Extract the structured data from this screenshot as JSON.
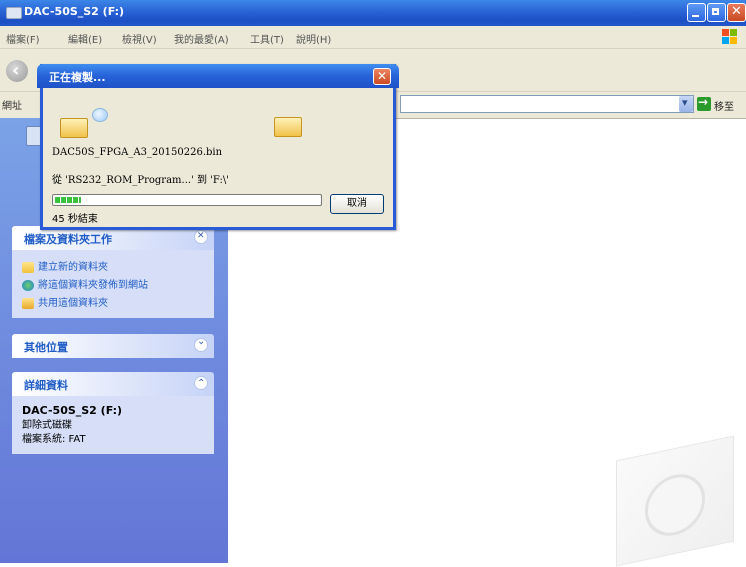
{
  "window": {
    "title": "DAC-50S_S2 (F:)",
    "menu": [
      "檔案(F)",
      "編輯(E)",
      "檢視(V)",
      "我的最愛(A)",
      "工具(T)",
      "說明(H)"
    ],
    "address_label": "網址",
    "go_label": "移至"
  },
  "dialog": {
    "title": "正在複製...",
    "file_name": "DAC50S_FPGA_A3_20150226.bin",
    "from_to": "從 'RS232_ROM_Program...' 到 'F:\\'",
    "time_left": "45 秒結束",
    "cancel_label": "取消",
    "progress_fraction": 0.1
  },
  "taskpane": {
    "tasks_title": "檔案及資料夾工作",
    "tasks": [
      {
        "label": "建立新的資料夾",
        "icon": "new-folder-icon"
      },
      {
        "label": "將這個資料夾發佈到網站",
        "icon": "globe-icon"
      },
      {
        "label": "共用這個資料夾",
        "icon": "share-folder-icon"
      }
    ],
    "other_places_title": "其他位置",
    "details_title": "詳細資料",
    "details": {
      "name": "DAC-50S_S2 (F:)",
      "type": "卸除式磁碟",
      "filesystem": "檔案系統: FAT"
    }
  },
  "colors": {
    "titlebar": "#2a63d6",
    "taskpane": "#6f8fe0",
    "progress": "#3cc13c"
  }
}
